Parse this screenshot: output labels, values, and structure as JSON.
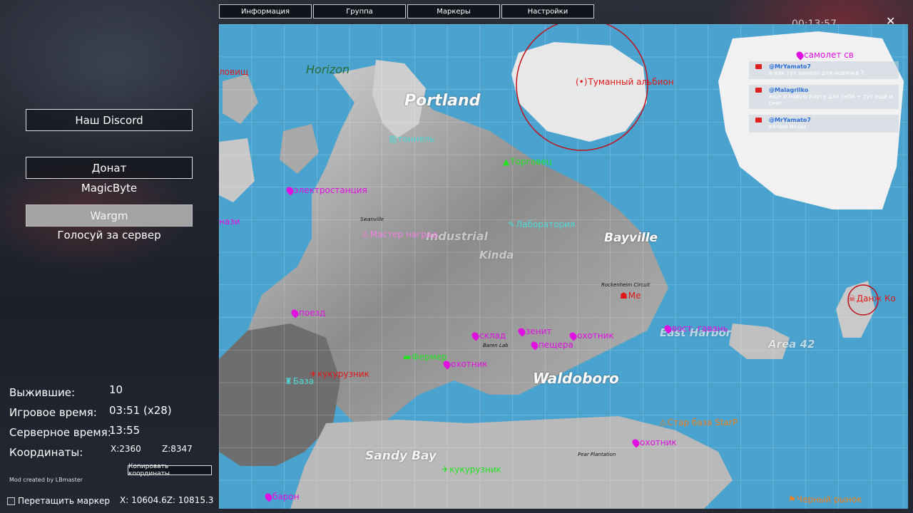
{
  "tabs": [
    "Информация",
    "Группа",
    "Маркеры",
    "Настройки"
  ],
  "clock": "00:13:57",
  "left": {
    "discord_label": "Наш Discord",
    "donate_label": "Донат",
    "donate_sub": "MagicByte",
    "vote_label": "Wargm",
    "vote_sub": "Голосуй за сервер",
    "stats": {
      "survivors_label": "Выжившие:",
      "survivors_value": "10",
      "game_time_label": "Игровое время:",
      "game_time_value": "03:51 (x28)",
      "server_time_label": "Серверное время:",
      "server_time_value": "13:55",
      "coords_label": "Координаты:",
      "coord_x": "X:2360",
      "coord_z": "Z:8347"
    },
    "copy_label": "Копировать координаты",
    "mod_credit": "Mod created by LBmaster",
    "drag_label": "Перетащить маркер",
    "cursor_coords": "X: 10604.6Z: 10815.3"
  },
  "map": {
    "places": {
      "horizon": "Horizon",
      "portland": "Portland",
      "bayville": "Bayville",
      "waldoboro": "Waldoboro",
      "sandy_bay": "Sandy Bay",
      "east_harbor": "East Harbor",
      "area42": "Area 42",
      "kinda": "Kinda",
      "tsitadel": "Industrial"
    },
    "towns": {
      "swanville": "Swanville",
      "rockenheim": "Rockenheim Circuit",
      "baren": "Baren Lab",
      "pear": "Pear Plantation"
    },
    "markers": {
      "foggy": "Туманный альбион",
      "plane": "самолет св",
      "tunnel": "тоннель",
      "elektro": "электростанция",
      "master": "Мастер наград",
      "lab": "Лаборатория",
      "nazi": "нази",
      "train": "поезд",
      "me": "Me",
      "vost": "вост. гавань",
      "dank": "Данж Ко",
      "zenit": "зенит",
      "hunter1": "охотник",
      "cave": "пещера",
      "fermer": "Фермер",
      "hunter2": "охотник",
      "warehouse": "склад",
      "plane2": "кукурузник",
      "base": "База",
      "starp": "Стар база StarP",
      "hunter3": "охотник",
      "corn": "кукурузник",
      "baron": "барон",
      "black": "Черный рынок",
      "north": "ловищ",
      "trader": "Торговец"
    }
  },
  "chat": [
    {
      "user": "@MrYamato7",
      "text": "а как тут начало для новичка ?"
    },
    {
      "user": "@Malagrilko",
      "text": "еще и новую карту для себя + тут еще и снег"
    },
    {
      "user": "@MrYamato7",
      "text": "качаю моды"
    }
  ]
}
